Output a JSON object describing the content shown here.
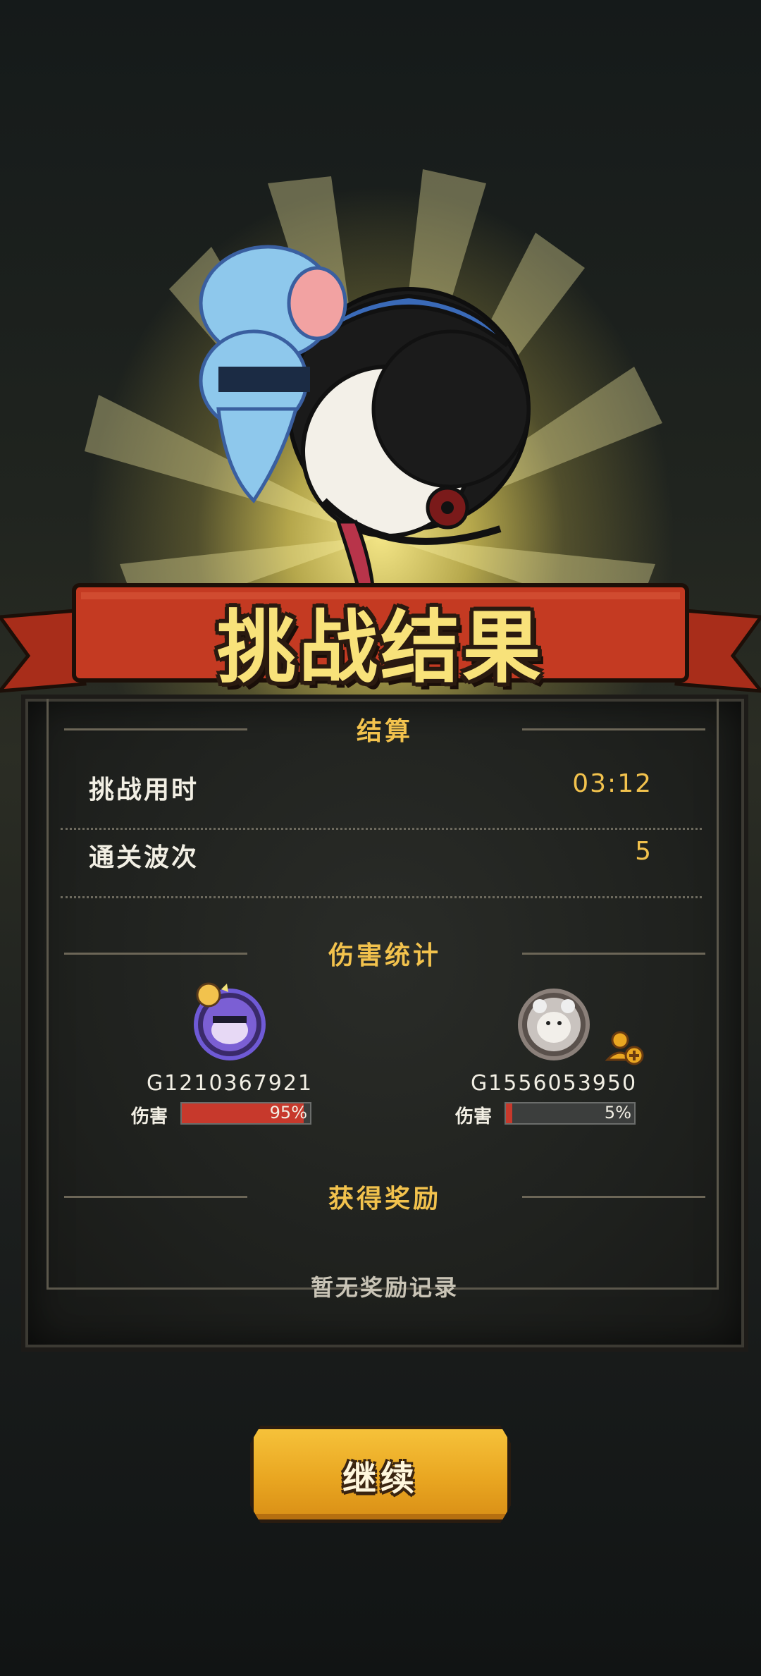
{
  "title": "挑战结果",
  "settlement": {
    "section_title": "结算",
    "rows": [
      {
        "label": "挑战用时",
        "value": "03:12"
      },
      {
        "label": "通关波次",
        "value": "5"
      }
    ]
  },
  "damage_stats": {
    "section_title": "伤害统计",
    "players": [
      {
        "id": "G1210367921",
        "damage_label": "伤害",
        "damage_percent": "95%",
        "damage_fraction": 0.95,
        "avatar_icon": "hero-avatar-icon"
      },
      {
        "id": "G1556053950",
        "damage_label": "伤害",
        "damage_percent": "5%",
        "damage_fraction": 0.05,
        "avatar_icon": "bear-avatar-icon",
        "extra_icon": "add-friend-icon"
      }
    ]
  },
  "rewards": {
    "section_title": "获得奖励",
    "empty_text": "暂无奖励记录"
  },
  "continue_button": {
    "label": "继续"
  },
  "colors": {
    "accent_gold": "#f2c24d",
    "banner_red": "#c43a22",
    "bar_red": "#c7392c",
    "button_gold": "#e9a621"
  }
}
